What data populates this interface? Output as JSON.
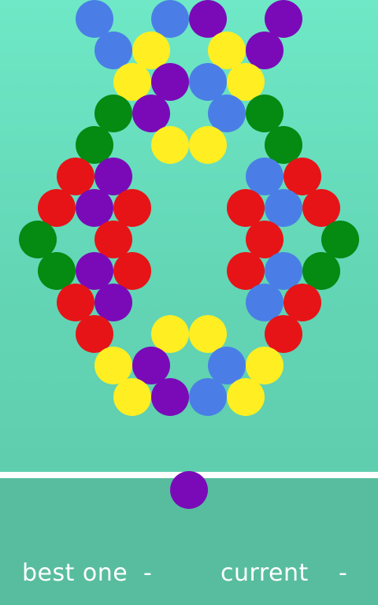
{
  "colors": {
    "blue": "#4a7ee6",
    "purple": "#7a0ab8",
    "yellow": "#ffee22",
    "green": "#058a12",
    "red": "#e61417"
  },
  "bubbles": [
    "blue",
    "blue",
    "purple",
    "purple",
    "blue",
    "yellow",
    "yellow",
    "purple",
    "yellow",
    "purple",
    "blue",
    "yellow",
    "green",
    "purple",
    "blue",
    "green",
    "green",
    "yellow",
    "yellow",
    "green",
    "red",
    "purple",
    "blue",
    "red",
    "red",
    "purple",
    "red",
    "red",
    "blue",
    "red",
    "green",
    "red",
    "red",
    "green",
    "green",
    "purple",
    "red",
    "red",
    "blue",
    "green",
    "red",
    "purple",
    "blue",
    "red",
    "red",
    "yellow",
    "yellow",
    "red",
    "yellow",
    "purple",
    "blue",
    "yellow",
    "yellow",
    "purple",
    "blue",
    "yellow"
  ],
  "current_bubble_color": "purple",
  "scoreboard": {
    "best_label": "best one",
    "best_value": "-",
    "current_label": "current",
    "current_value": "-"
  }
}
